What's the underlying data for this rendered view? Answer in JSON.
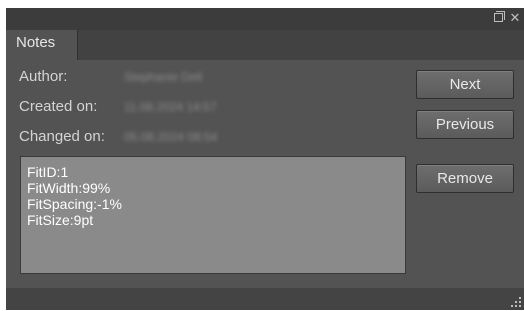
{
  "window": {
    "restore_icon": "restore-icon",
    "close_icon": "close-icon",
    "close_glyph": "✕"
  },
  "tabs": [
    {
      "label": "Notes"
    }
  ],
  "fields": {
    "author_label": "Author:",
    "author_value": "Stephanie Dell",
    "created_label": "Created on:",
    "created_value": "11.08.2024 14:57",
    "changed_label": "Changed on:",
    "changed_value": "05.08.2024 08:54"
  },
  "note_text": "FitID:1\nFitWidth:99%\nFitSpacing:-1%\nFitSize:9pt",
  "buttons": {
    "next": "Next",
    "previous": "Previous",
    "remove": "Remove"
  },
  "colors": {
    "panel": "#535353",
    "titlebar": "#3c3c3c",
    "note_background": "#8a8a8a",
    "text": "#d4d4d4"
  }
}
